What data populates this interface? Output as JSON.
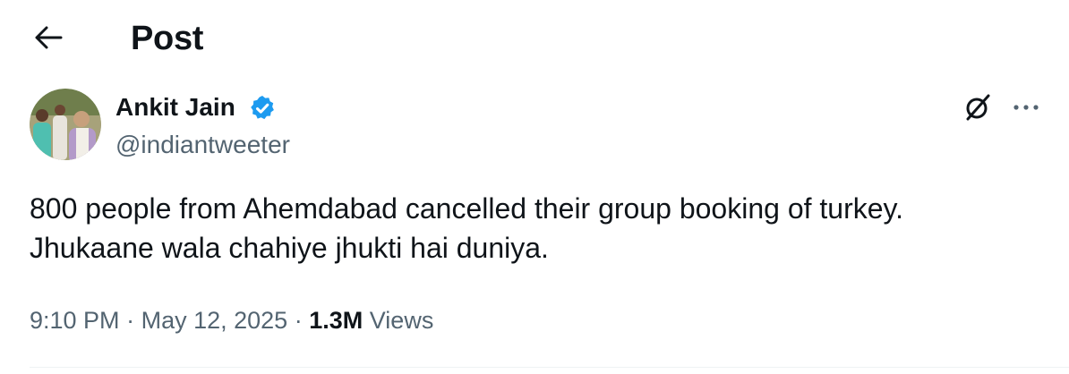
{
  "header": {
    "back_icon": "arrow-left-icon",
    "title": "Post"
  },
  "author": {
    "name": "Ankit Jain",
    "handle": "@indiantweeter",
    "verified_icon": "verified-badge-icon",
    "verified_color": "#1d9bf0",
    "avatar_icon": "profile-photo"
  },
  "actions": {
    "grok_icon": "grok-icon",
    "more_icon": "more-horizontal-icon"
  },
  "tweet": {
    "lines": [
      "800 people from Ahemdabad cancelled their group booking of turkey.",
      "Jhukaane wala chahiye jhukti hai duniya."
    ]
  },
  "meta": {
    "time": "9:10 PM",
    "separator": "·",
    "date": "May 12, 2025",
    "views_count": "1.3M",
    "views_label": "Views"
  },
  "colors": {
    "text_primary": "#0f1419",
    "text_secondary": "#536471",
    "divider": "#eff3f4"
  }
}
